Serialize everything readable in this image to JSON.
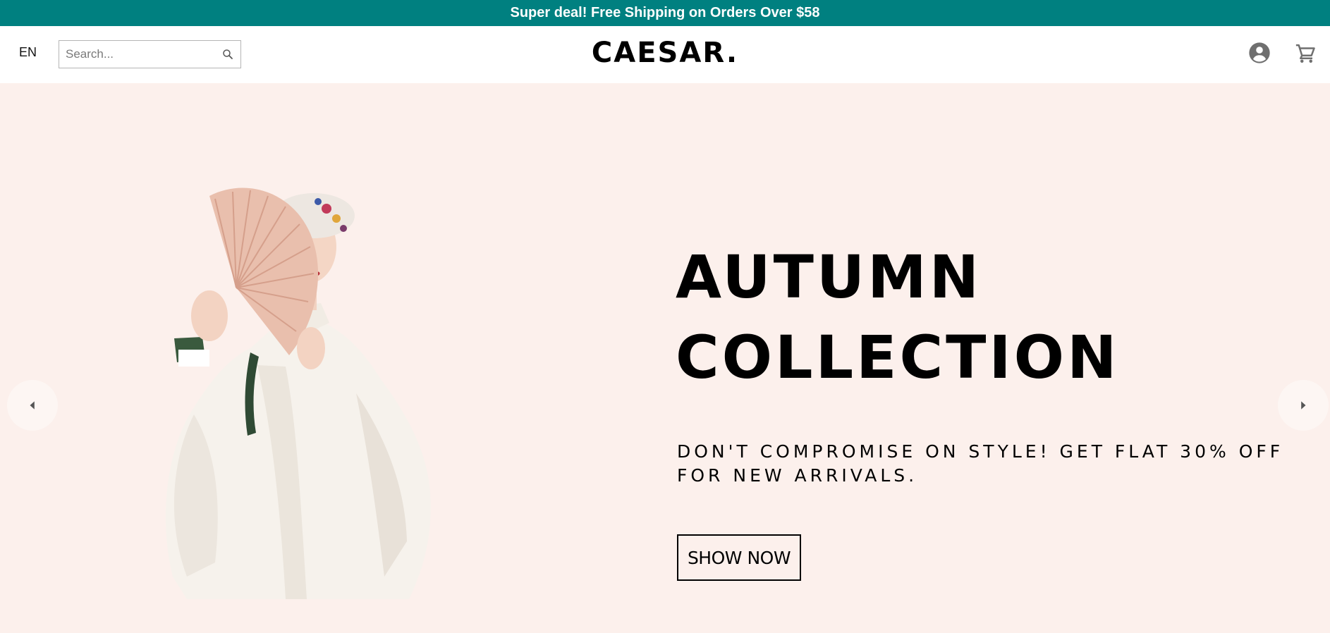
{
  "announcement": {
    "text": "Super deal! Free Shipping on Orders Over $58",
    "background": "#008080"
  },
  "header": {
    "language": "EN",
    "search": {
      "placeholder": "Search...",
      "value": "",
      "icon": "search-icon"
    },
    "logo": "CAESAR.",
    "icons": {
      "user": "user-circle-icon",
      "cart": "shopping-cart-icon"
    }
  },
  "hero": {
    "background": "#fcf0ec",
    "title_line1": "AUTUMN",
    "title_line2": "COLLECTION",
    "subtitle": "DON'T COMPROMISE ON STYLE! GET FLAT 30% OFF FOR NEW ARRIVALS.",
    "button": "SHOW NOW",
    "image": "woman-with-fan-photo",
    "prev_icon": "caret-left-icon",
    "next_icon": "caret-right-icon"
  }
}
